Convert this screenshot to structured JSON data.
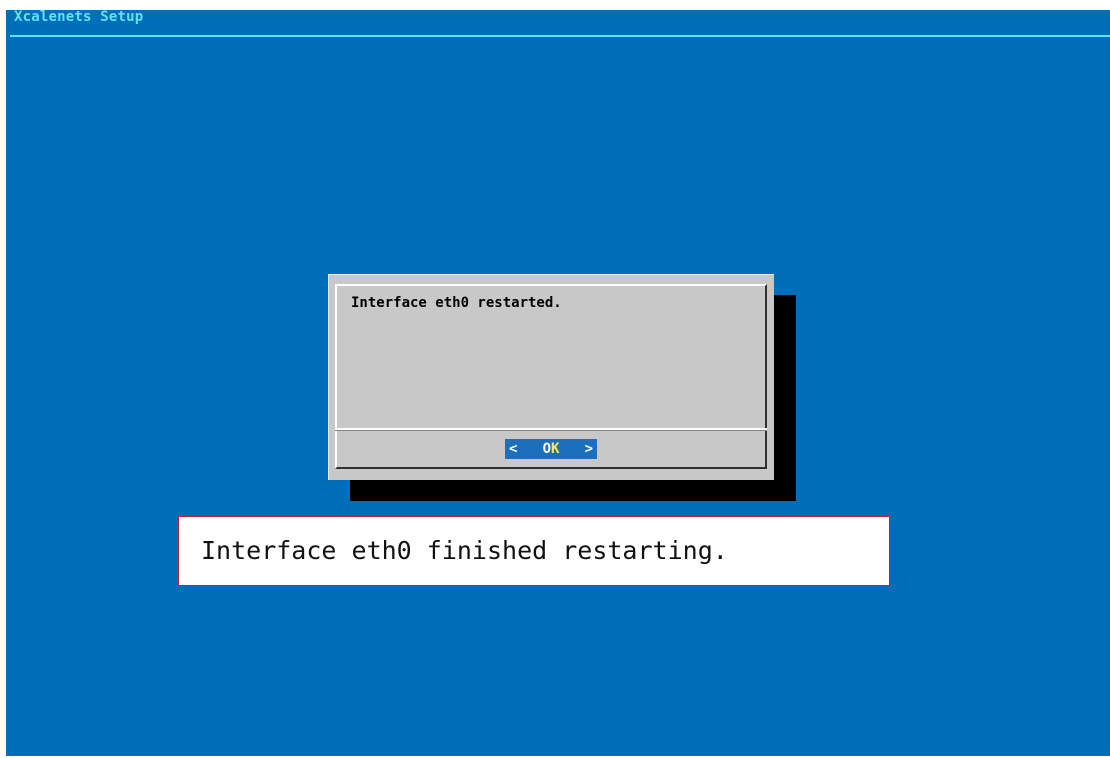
{
  "app": {
    "title": "Xcalenets Setup"
  },
  "dialog": {
    "message": "Interface eth0 restarted.",
    "ok_button": {
      "left_bracket": "<",
      "label_hotkey": "O",
      "label_rest": "K",
      "right_bracket": ">"
    }
  },
  "caption": {
    "text": "Interface eth0 finished restarting."
  },
  "colors": {
    "background": "#006fb9",
    "title": "#5fe3f2",
    "dialog": "#c8c8c8",
    "button_bg": "#1b6fbd",
    "hotkey": "#f5f05a",
    "caption_border": "#d0192b"
  }
}
